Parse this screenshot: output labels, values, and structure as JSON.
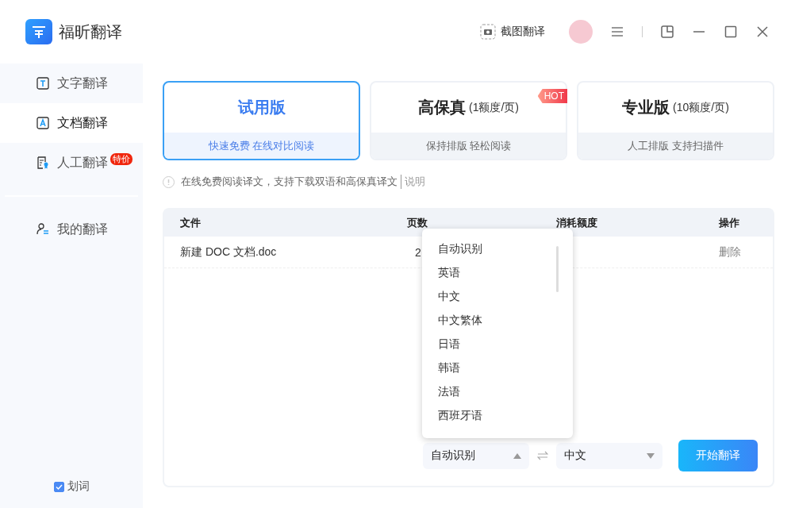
{
  "app": {
    "name": "福昕翻译"
  },
  "toolbar": {
    "screenshot_label": "截图翻译"
  },
  "sidebar": {
    "items": [
      {
        "kind": "text",
        "label": "文字翻译",
        "selected": false
      },
      {
        "kind": "document",
        "label": "文档翻译",
        "selected": true
      },
      {
        "kind": "human",
        "label": "人工翻译",
        "selected": false,
        "badge": "特价"
      },
      {
        "kind": "mine",
        "label": "我的翻译",
        "selected": false
      }
    ],
    "word_select": {
      "label": "划词",
      "checked": true
    }
  },
  "plans": [
    {
      "title": "试用版",
      "subtitle": "快速免费 在线对比阅读",
      "selected": true
    },
    {
      "title": "高保真",
      "price": "(1额度/页)",
      "subtitle": "保持排版 轻松阅读",
      "selected": false,
      "badge": "HOT"
    },
    {
      "title": "专业版",
      "price": "(10额度/页)",
      "subtitle": "人工排版 支持扫描件",
      "selected": false
    }
  ],
  "note": {
    "text": "在线免费阅读译文，支持下载双语和高保真译文",
    "link": "说明"
  },
  "table": {
    "columns": [
      "文件",
      "页数",
      "消耗额度",
      "操作"
    ],
    "rows": [
      {
        "file": "新建 DOC 文档.doc",
        "pages": "2",
        "action": "删除"
      }
    ]
  },
  "language_menu": {
    "items": [
      "自动识别",
      "英语",
      "中文",
      "中文繁体",
      "日语",
      "韩语",
      "法语",
      "西班牙语"
    ]
  },
  "source_language": {
    "value": "自动识别",
    "expanded": true
  },
  "target_language": {
    "value": "中文",
    "expanded": false
  },
  "start_button": "开始翻译"
}
